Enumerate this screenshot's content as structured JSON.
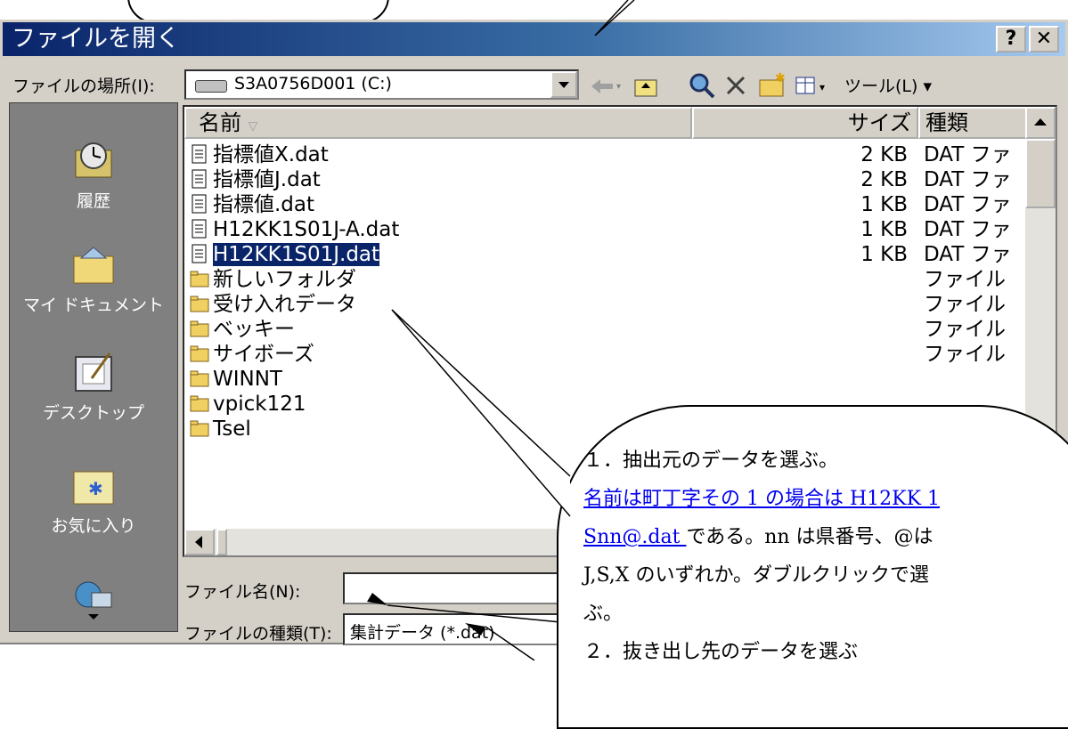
{
  "window": {
    "title": "ファイルを開く",
    "help_button": "?",
    "close_button": "✕"
  },
  "toolbar": {
    "location_label": "ファイルの場所(I):",
    "location_value": "S3A0756D001 (C:)",
    "tools_label": "ツール(L)"
  },
  "places": [
    {
      "label": "履歴",
      "icon": "history-icon"
    },
    {
      "label": "マイ ドキュメント",
      "icon": "my-documents-icon"
    },
    {
      "label": "デスクトップ",
      "icon": "desktop-icon"
    },
    {
      "label": "お気に入り",
      "icon": "favorites-icon"
    },
    {
      "label": "",
      "icon": "network-icon"
    }
  ],
  "list": {
    "columns": {
      "name": "名前",
      "size": "サイズ",
      "type": "種類"
    },
    "rows": [
      {
        "name": "指標値X.dat",
        "size": "2 KB",
        "type": "DAT ファ",
        "kind": "file"
      },
      {
        "name": "指標値J.dat",
        "size": "2 KB",
        "type": "DAT ファ",
        "kind": "file"
      },
      {
        "name": "指標値.dat",
        "size": "1 KB",
        "type": "DAT ファ",
        "kind": "file"
      },
      {
        "name": "H12KK1S01J-A.dat",
        "size": "1 KB",
        "type": "DAT ファ",
        "kind": "file"
      },
      {
        "name": "H12KK1S01J.dat",
        "size": "1 KB",
        "type": "DAT ファ",
        "kind": "file",
        "selected": true
      },
      {
        "name": "新しいフォルダ",
        "size": "",
        "type": "ファイル",
        "kind": "folder"
      },
      {
        "name": "受け入れデータ",
        "size": "",
        "type": "ファイル",
        "kind": "folder"
      },
      {
        "name": "ベッキー",
        "size": "",
        "type": "ファイル",
        "kind": "folder"
      },
      {
        "name": "サイボーズ",
        "size": "",
        "type": "ファイル",
        "kind": "folder"
      },
      {
        "name": "WINNT",
        "size": "",
        "type": "",
        "kind": "folder"
      },
      {
        "name": "vpick121",
        "size": "",
        "type": "",
        "kind": "folder"
      },
      {
        "name": "Tsel",
        "size": "",
        "type": "",
        "kind": "folder"
      }
    ]
  },
  "footer": {
    "filename_label": "ファイル名(N):",
    "filename_value": "",
    "filetype_label": "ファイルの種類(T):",
    "filetype_value": "集計データ (*.dat)"
  },
  "callout": {
    "line1": "１．抽出元のデータを選ぶ。",
    "line2_link": "名前は町丁字その 1 の場合は H12KK 1",
    "line3_link": "Snn@.dat ",
    "line3_rest": "である。nn は県番号、@は",
    "line4": "J,S,X のいずれか。ダブルクリックで選",
    "line5": "ぶ。",
    "line6": "２．抜き出し先のデータを選ぶ"
  }
}
